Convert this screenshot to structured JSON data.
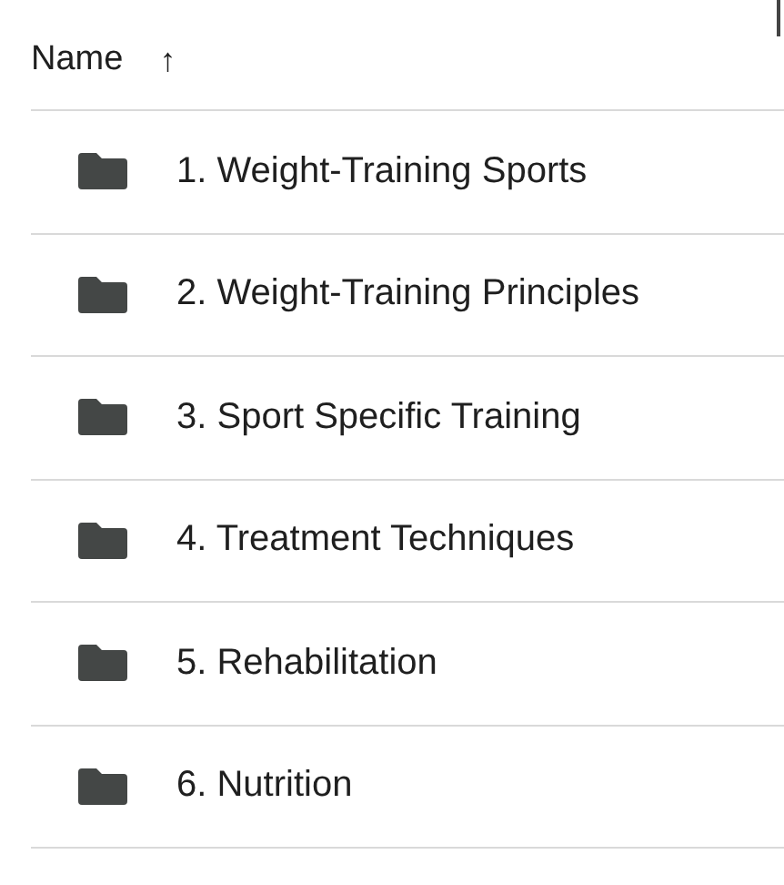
{
  "header": {
    "label": "Name",
    "sort_indicator": "↑"
  },
  "rows": [
    {
      "kind": "folder",
      "name": "1. Weight-Training Sports"
    },
    {
      "kind": "folder",
      "name": "2. Weight-Training Principles"
    },
    {
      "kind": "folder",
      "name": "3. Sport Specific Training"
    },
    {
      "kind": "folder",
      "name": "4. Treatment Techniques"
    },
    {
      "kind": "folder",
      "name": "5. Rehabilitation"
    },
    {
      "kind": "folder",
      "name": "6. Nutrition"
    }
  ]
}
